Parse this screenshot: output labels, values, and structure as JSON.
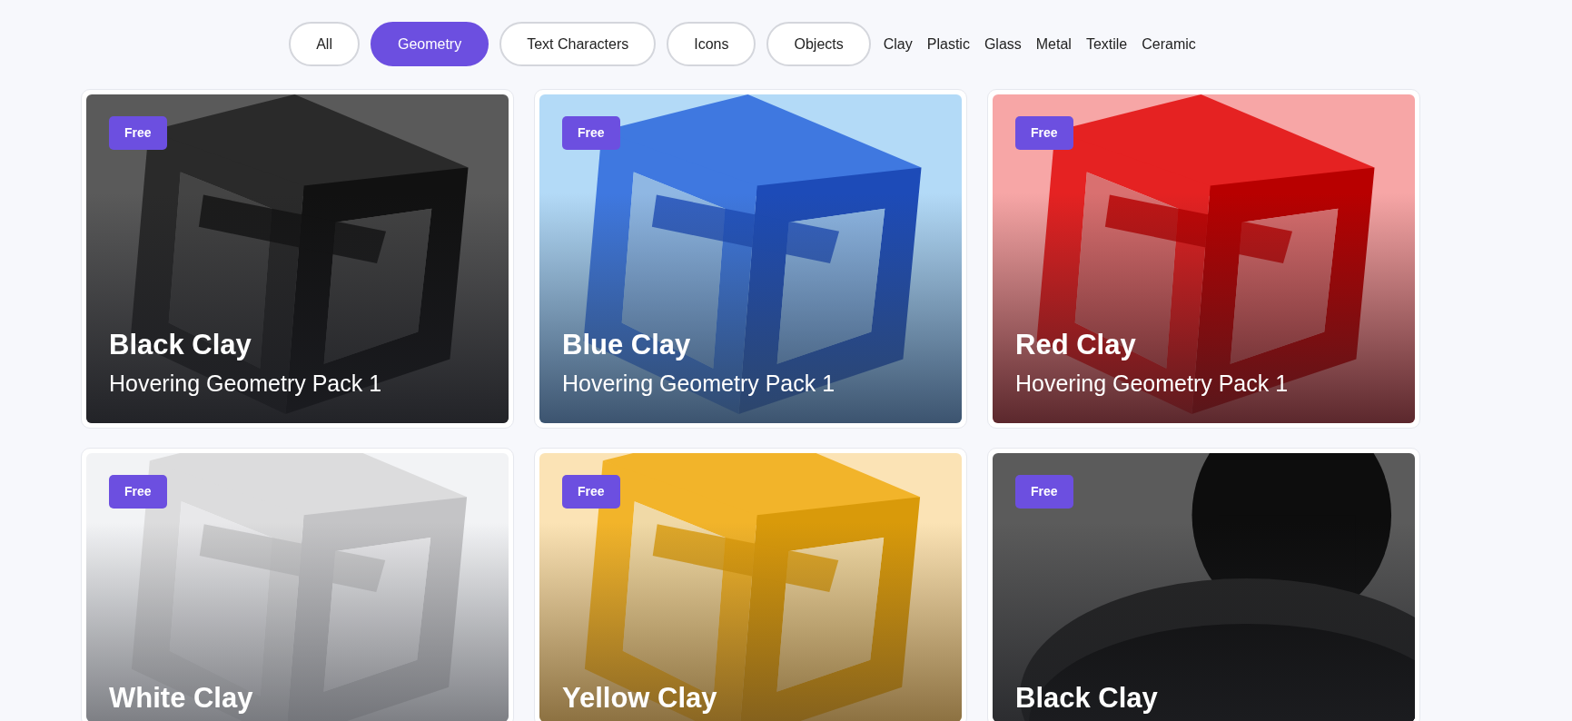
{
  "filters": [
    {
      "label": "All",
      "kind": "pill",
      "selected": false
    },
    {
      "label": "Geometry",
      "kind": "pill",
      "selected": true
    },
    {
      "label": "Text Characters",
      "kind": "pill",
      "selected": false
    },
    {
      "label": "Icons",
      "kind": "pill",
      "selected": false
    },
    {
      "label": "Objects",
      "kind": "pill",
      "selected": false
    },
    {
      "label": "Clay",
      "kind": "text",
      "selected": false
    },
    {
      "label": "Plastic",
      "kind": "text",
      "selected": false
    },
    {
      "label": "Glass",
      "kind": "text",
      "selected": false
    },
    {
      "label": "Metal",
      "kind": "text",
      "selected": false
    },
    {
      "label": "Textile",
      "kind": "text",
      "selected": false
    },
    {
      "label": "Ceramic",
      "kind": "text",
      "selected": false
    }
  ],
  "cards": [
    {
      "badge": "Free",
      "title": "Black Clay",
      "subtitle": "Hovering Geometry Pack 1",
      "kind": "picture"
    },
    {
      "badge": "Free",
      "title": "Blue Clay",
      "subtitle": "Hovering Geometry Pack 1",
      "kind": "picture"
    },
    {
      "badge": "Free",
      "title": "Red Clay",
      "subtitle": "Hovering Geometry Pack 1",
      "kind": "picture"
    },
    {
      "badge": "Free",
      "title": "White Clay",
      "kind": "picture"
    },
    {
      "badge": "Free",
      "title": "Yellow Clay",
      "kind": "picture"
    },
    {
      "badge": "Free",
      "title": "Black Clay",
      "kind": "picture"
    }
  ]
}
